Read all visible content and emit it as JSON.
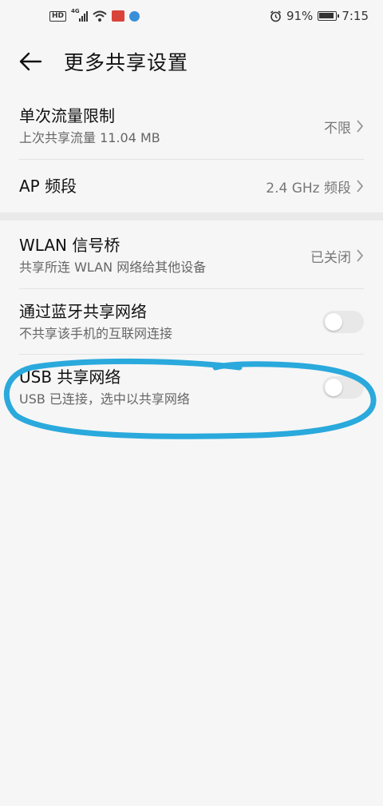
{
  "status_bar": {
    "network_label": "4G",
    "hd_label": "HD",
    "battery_percent": "91%",
    "time": "7:15",
    "icons": [
      "hd-icon",
      "signal-icon",
      "wifi-icon",
      "app-notification-icon",
      "app-notification-icon",
      "alarm-icon",
      "battery-icon"
    ]
  },
  "header": {
    "title": "更多共享设置"
  },
  "settings": {
    "traffic_limit": {
      "title": "单次流量限制",
      "subtitle": "上次共享流量 11.04 MB",
      "value": "不限"
    },
    "ap_band": {
      "title": "AP 频段",
      "value": "2.4 GHz 频段"
    },
    "wlan_bridge": {
      "title": "WLAN 信号桥",
      "subtitle": "共享所连 WLAN 网络给其他设备",
      "value": "已关闭"
    },
    "bluetooth_tether": {
      "title": "通过蓝牙共享网络",
      "subtitle": "不共享该手机的互联网连接",
      "enabled": false
    },
    "usb_tether": {
      "title": "USB 共享网络",
      "subtitle": "USB 已连接，选中以共享网络",
      "enabled": false
    }
  },
  "colors": {
    "annotation_stroke": "#2aa9dc",
    "toggle_off": "#e8e8e8"
  }
}
